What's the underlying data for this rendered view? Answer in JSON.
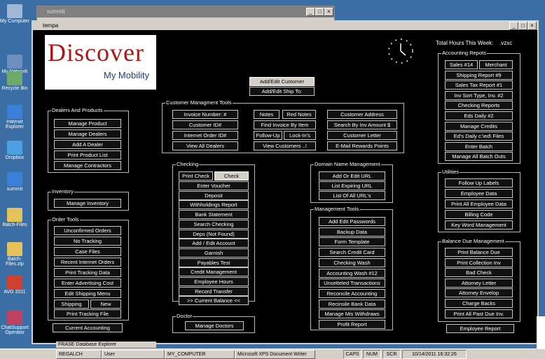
{
  "desktop": {
    "icons": [
      {
        "label": "My Computer",
        "color": "#9fb8d8"
      },
      {
        "label": "My Network Places",
        "color": "#6d8fbf"
      },
      {
        "label": "Recycle Bin",
        "color": "#6fa86b"
      },
      {
        "label": "Internet Explorer",
        "color": "#3a7fd8"
      },
      {
        "label": "Dropbox",
        "color": "#4aa0e0"
      },
      {
        "label": "summit",
        "color": "#3a7fd8"
      },
      {
        "label": "Batch-Files",
        "color": "#e5c25a"
      },
      {
        "label": "Batch-Files.zip",
        "color": "#e5c25a"
      },
      {
        "label": "AVG 2011",
        "color": "#d04030"
      },
      {
        "label": "ChatSupport Operator",
        "color": "#c04060"
      }
    ]
  },
  "back_window": {
    "title": "summit"
  },
  "main_window": {
    "title": "tempa",
    "logo": {
      "big": "Discover",
      "small": "My Mobility"
    },
    "total_hours_label": "Total Hours This Week:",
    "total_hours_value": ".vzxc",
    "customer_buttons": {
      "add_edit": "Add/Edit Customer",
      "ship_to": "Add/Edit Ship To:"
    },
    "groups": {
      "dealers": {
        "label": "Dealers And Products",
        "items": [
          "Manage Product",
          "Manage Dealers",
          "Add A Dealer",
          "Print Product List",
          "Manage Contractors"
        ]
      },
      "inventory": {
        "label": "Inventory",
        "items": [
          "Manage Inventory"
        ]
      },
      "order_tools": {
        "label": "Order Tools",
        "items": [
          "Unconfirmed Orders",
          "No Tracking",
          "Case Files",
          "Recent Internet Orders",
          "Print Tracking Data",
          "Enter Advertising Cost",
          "Edit Shipping Menu",
          "Shipping",
          "New",
          "Print Tracking File"
        ]
      },
      "current_accounting": "Current Accounting",
      "customer_tools": {
        "label": "Customer Managment Tools",
        "items": [
          "Invoice Number: #",
          "Notes",
          "Red Notes",
          "Customer Address",
          "Customer ID#",
          "Find Invoice By Item",
          "Search By Inv Amount $",
          "Internet Order ID#",
          "Follow-Up",
          "Lock-In's",
          "Customer Letter",
          "View All Dealers",
          "View Customers ..!",
          "E-Mail Rewards Points"
        ]
      },
      "checking": {
        "label": "Checking",
        "items": [
          "Print Check",
          "Check",
          "Enter Voucher",
          "Deposit",
          "Withholdings Report",
          "Bank Statement",
          "Search Checking",
          "Deps (Not Found)",
          "Add / Edit Account",
          "Garnish",
          "Payables Test",
          "Credit Management",
          "Employee Hours",
          "Record Transfer",
          ">> Current Balance <<"
        ]
      },
      "doctor": {
        "label": "Doctor",
        "items": [
          "Manage Doctors"
        ]
      },
      "domain": {
        "label": "Domain Name Management",
        "items": [
          "Add Or Edit URL",
          "List Expiring URL",
          "List Of All URL's"
        ]
      },
      "management": {
        "label": "Management Tools",
        "items": [
          "Add Edit Passwords",
          "Backup Data",
          "Form Template",
          "Search Credit Card",
          "Checking Wash",
          "Accounting Wash #12",
          "Unsetteled Transactions",
          "Reconcile Accounting",
          "Recinsile Bank Data",
          "Manage Mis Withdraws",
          "Profit Report"
        ]
      },
      "accounting_reports": {
        "label": "Accounting Repots",
        "items": [
          "Sales #14",
          "Merchant",
          "Shipping Report #9",
          "Sales Tax Report #1",
          "Inv Sort Type, Inv. #2",
          "Checking Reports",
          "Eds Daily #2",
          "Manage Credits",
          "Ed's Daily c:\\ed\\ Files",
          "Enter Batch",
          "Manage All Batch Outs"
        ]
      },
      "utilities": {
        "label": "Utilities",
        "items": [
          "Follow Up Labels",
          "Employee Data",
          "Print All Employee Data",
          "Billing Code",
          "Key Word Management"
        ]
      },
      "balance_due": {
        "label": "Balance Due Management",
        "items": [
          "Print Balance Due",
          "Print Collection Inv",
          "Bad Check",
          "Attorney Letter",
          "Attorney Envelop",
          "Charge Backs",
          "Print All Past Due Inv."
        ]
      },
      "employee_report": "Employee Report"
    }
  },
  "below_strip": "FRASE Database Explorer",
  "taskbar": {
    "tasks": [
      "REGALCH",
      "User",
      "MY_COMPUTER",
      "Microsoft XPS Document Writer"
    ],
    "tray": [
      "CAPS",
      "NUM",
      "SCR",
      "10/14/2011 16:32:26"
    ]
  }
}
